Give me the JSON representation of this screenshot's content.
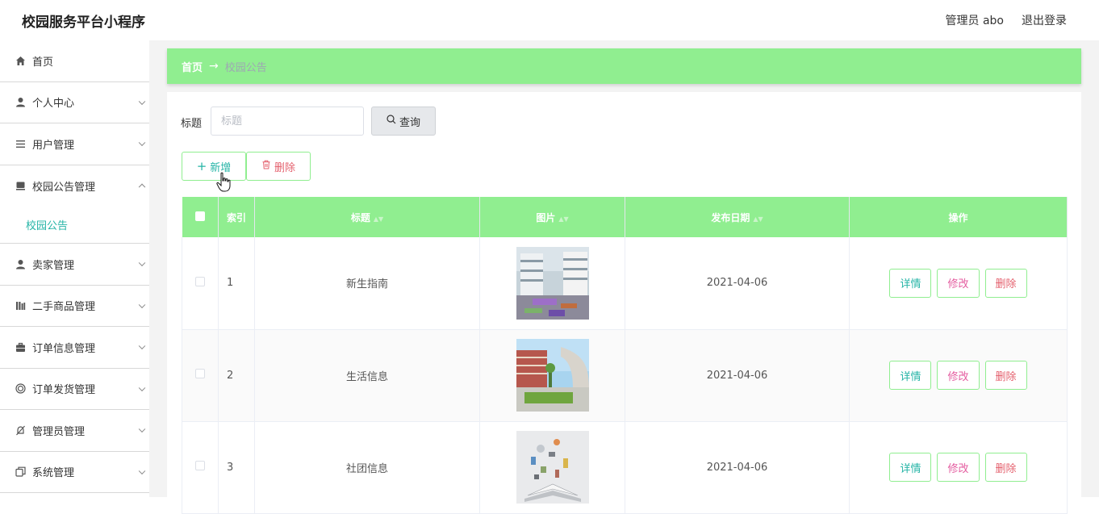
{
  "app": {
    "title": "校园服务平台小程序"
  },
  "header": {
    "user_label": "管理员 abo",
    "logout_label": "退出登录"
  },
  "sidebar": {
    "items": [
      {
        "label": "首页",
        "icon": "home-icon"
      },
      {
        "label": "个人中心",
        "icon": "user-icon"
      },
      {
        "label": "用户管理",
        "icon": "list-icon"
      },
      {
        "label": "校园公告管理",
        "icon": "notice-icon",
        "expanded": true
      },
      {
        "label": "卖家管理",
        "icon": "user-icon"
      },
      {
        "label": "二手商品管理",
        "icon": "bars-icon"
      },
      {
        "label": "订单信息管理",
        "icon": "briefcase-icon"
      },
      {
        "label": "订单发货管理",
        "icon": "circle-icon"
      },
      {
        "label": "管理员管理",
        "icon": "slash-icon"
      },
      {
        "label": "系统管理",
        "icon": "copy-icon"
      }
    ],
    "subitem": "校园公告"
  },
  "breadcrumb": {
    "home": "首页",
    "separator": "→",
    "current": "校园公告"
  },
  "search": {
    "label": "标题",
    "placeholder": "标题",
    "button": "查询"
  },
  "actions": {
    "add": "新增",
    "delete": "删除"
  },
  "table": {
    "columns": {
      "index": "索引",
      "title": "标题",
      "image": "图片",
      "date": "发布日期",
      "ops": "操作"
    },
    "rows": [
      {
        "index": "1",
        "title": "新生指南",
        "date": "2021-04-06"
      },
      {
        "index": "2",
        "title": "生活信息",
        "date": "2021-04-06"
      },
      {
        "index": "3",
        "title": "社团信息",
        "date": "2021-04-06"
      }
    ],
    "ops": {
      "detail": "详情",
      "edit": "修改",
      "remove": "删除"
    }
  },
  "colors": {
    "accent_green": "#90ee90",
    "teal": "#25b4a6",
    "pink": "#e45da0",
    "red": "#e4606d"
  }
}
